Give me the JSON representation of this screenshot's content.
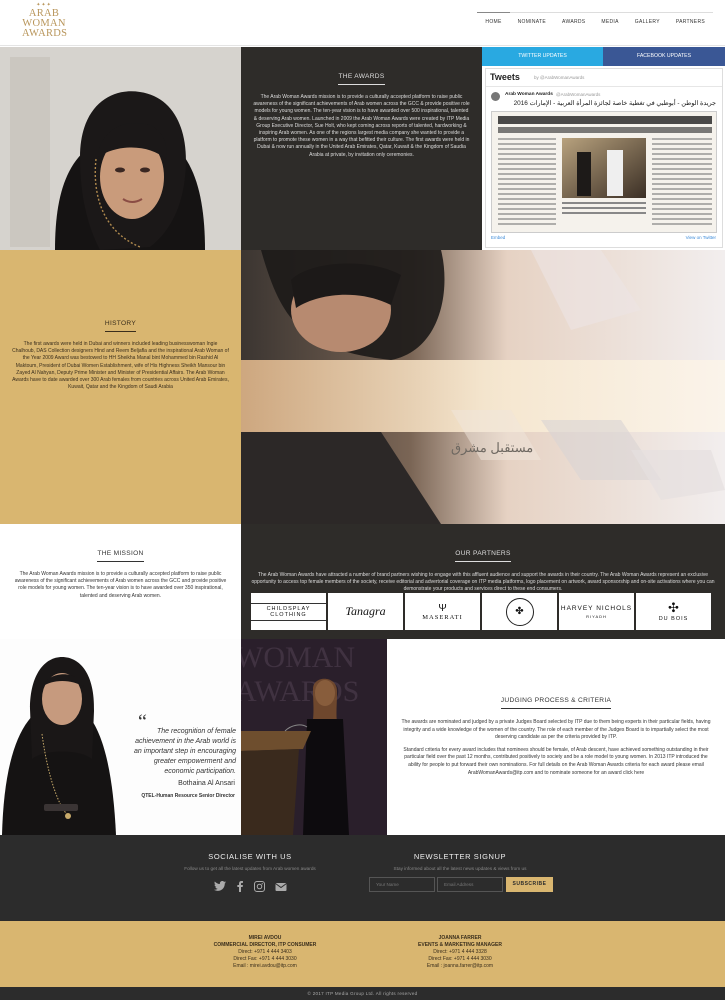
{
  "header": {
    "logo_text": [
      "ARAB",
      "WOMAN",
      "AWARDS"
    ],
    "nav": [
      "HOME",
      "NOMINATE",
      "AWARDS",
      "MEDIA",
      "GALLERY",
      "PARTNERS"
    ]
  },
  "awards": {
    "title": "THE AWARDS",
    "text": "The Arab Woman Awards mission is to provide a culturally accepted platform to raise public awareness of the significant achievements of Arab women across the GCC & provide positive role models for young women. The ten-year vision is to have awarded over 500 inspirational, talented & deserving Arab women. Launched in 2009 the Arab Woman Awards were created by ITP Media Group Executive Director, Sue Holt, who kept coming across reports of talented, hardworking & inspiring Arab women. As one of the regions largest media company she wanted to provide a platform to promote these women in a way that befitted their culture. The first awards were held in Dubai & now run annually in the United Arab Emirates, Qatar, Kuwait & the Kingdom of Saudia Arabia at private, by invitation only ceremonies."
  },
  "social_feed": {
    "twitter_tab": "TWITTER UPDATES",
    "facebook_tab": "FACEBOOK UPDATES",
    "heading": "Tweets",
    "by": "by @ArabWomanAwards",
    "account_name": "Arab Woman Awards",
    "account_handle": "@ArabWomanAwards",
    "tweet_text": "جريدة الوطن - أبوظبي في تغطية خاصة لجائزة المرأة العربية - الإمارات 2016",
    "embed": "Embed",
    "view": "View on Twitter"
  },
  "history": {
    "title": "HISTORY",
    "text": "The first awards were held in Dubai and winners included leading businesswoman Ingie Chalhoub, DAS Collection designers Hind and Reem Beljafla and the inspirational Arab Woman of the Year 2009 Award was bestowed to HH Sheikha Manal bint Mohammed bin Rashid Al Maktoum, President of Dubai Women Establishment, wife of His Highness Sheikh Mansour bin Zayed Al Nahyan, Deputy Prime Minister and Minister of Presidential Affairs. The Arab Woman Awards have to date awarded over 300 Arab females from countries across United Arab Emirates, Kuwait, Qatar and the Kingdom of Saudi Arabia"
  },
  "video": {
    "arabic_caption": "مستقبل مشرق"
  },
  "mission": {
    "title": "THE MISSION",
    "text": "The Arab Woman Awards mission is to provide a culturally accepted platform to raise public awareness of the significant achievements of Arab women across the GCC and provide positive role models for young women. The ten-year vision is to have awarded over 350 inspirational, talented and deserving Arab women."
  },
  "partners": {
    "title": "OUR PARTNERS",
    "text": "The Arab Woman Awards have attracted a number of brand partners wishing to engage with this affluent audience and support the awards in their country. The Arab Woman Awards represent an exclusive opportunity to access top female members of the society, receive editorial and advertorial coverage on ITP media platforms, logo placement on artwork, award sponsorship and on-site activations where you can demonstrate your products and services direct to these end consumers.",
    "logos": [
      "CHILDSPLAY CLOTHING",
      "Tanagra",
      "MASERATI",
      "",
      "HARVEY NICHOLS",
      "DU BOIS"
    ],
    "harvey_sub": "RIYADH"
  },
  "quote": {
    "mark": "“",
    "text": "The recognition of female achievement in the Arab world is an important step in encouraging greater empowerment and economic participation.",
    "name": "Bothaina Al Ansari",
    "role": "QTEL-Human Resource Senior Director"
  },
  "judging": {
    "title": "JUDGING PROCESS & CRITERIA",
    "p1": "The awards are nominated and judged by a private Judges Board selected by ITP due to them being experts in their particular fields, having integrity and a wide knowledge of the women of the country. The role of each member of the Judges Board is to impartially select the most deserving candidate as per the criteria provided by ITP.",
    "p2": "Standard criteria for every award includes that nominees should be female, of Arab descent, have achieved something outstanding in their particular field over the past 12 months, contributed positively to society and be a role model to young women. In 2013 ITP introduced the ability for people to put forward their own nominations. For full details on the Arab Woman Awards criteria for each award please email ArabWomanAwards@itp.com and to nominate someone for an award click here"
  },
  "footer": {
    "social_title": "SOCIALISE WITH US",
    "social_sub": "Follow us to get all the latest updates from Arab women awards",
    "newsletter_title": "NEWSLETTER SIGNUP",
    "newsletter_sub": "Stay informed about all the latest news updates & views from us",
    "name_placeholder": "Your Name",
    "email_placeholder": "Email Address",
    "subscribe": "SUBSCRIBE",
    "contacts": [
      {
        "name": "MIREI AVDOU",
        "title": "COMMERCIAL DIRECTOR, ITP CONSUMER",
        "direct": "Direct: +971 4 444 3403",
        "fax": "Direct Fax: +971 4 444 3030",
        "email": "Email : mirei.avdou@itp.com"
      },
      {
        "name": "JOANNA FARRER",
        "title": "EVENTS & MARKETING MANAGER",
        "direct": "Direct: +971 4 444 3328",
        "fax": "Direct Fax: +971 4 444 3030",
        "email": "Email : joanna.farrer@itp.com"
      }
    ],
    "copyright": "© 2017 ITP Media Group Ltd. All rights reserved"
  },
  "colors": {
    "gold": "#d9b670",
    "dark": "#2e2c29",
    "twitter": "#29a9e1",
    "facebook": "#3a5795"
  },
  "icons": [
    "twitter-icon",
    "facebook-icon",
    "instagram-icon",
    "email-icon"
  ]
}
